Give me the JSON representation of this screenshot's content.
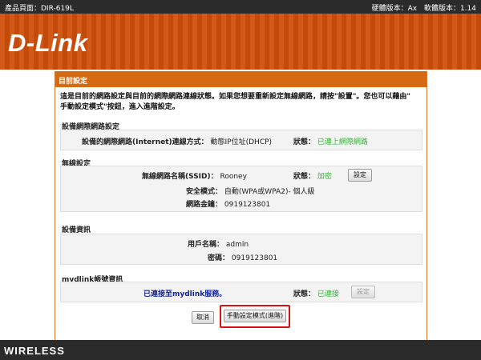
{
  "topbar": {
    "model": "產品頁面：DIR-619L",
    "hw_version": "硬體版本：Ax",
    "fw_version": "軟體版本：1.14"
  },
  "brand": {
    "logo": "D-Link"
  },
  "panel": {
    "title": "目前設定",
    "intro_line1": "這是目前的網路設定與目前的網際網路連線狀態。如果您想要重新設定無線網路，請按\"設置\"。您也可以藉由\"",
    "intro_line2": "手動設定模式\"按鈕，進入進階設定。"
  },
  "internet": {
    "title": "設備網際網路設定",
    "conn_label": "設備的網際網路(Internet)連線方式：",
    "conn_value": "動態IP位址(DHCP)",
    "status_label": "狀態：",
    "status_value": "已連上網際網路"
  },
  "wireless": {
    "title": "無線設定",
    "ssid_label": "無線網路名稱(SSID)：",
    "ssid_value": "Rooney",
    "status_label": "狀態：",
    "status_value": "加密",
    "setup_button": "設定",
    "security_label": "安全模式：",
    "security_value": "自動(WPA或WPA2)- 個人級",
    "key_label": "網路金鑰：",
    "key_value": "0919123801"
  },
  "device": {
    "title": "設備資訊",
    "user_label": "用戶名稱：",
    "user_value": "admin",
    "pwd_label": "密碼：",
    "pwd_value": "0919123801"
  },
  "mydlink": {
    "title": "mydlink帳號資訊",
    "link": "已連接至mydlink服務。",
    "status_label": "狀態：",
    "status_value": "已連接",
    "setup_button": "設定"
  },
  "actions": {
    "cancel": "取消",
    "manual": "手動設定模式(進階)"
  },
  "footer": {
    "label": "WIRELESS"
  },
  "colors": {
    "accent": "#d56a12",
    "status_ok": "#36b336",
    "highlight": "#dd1111"
  }
}
